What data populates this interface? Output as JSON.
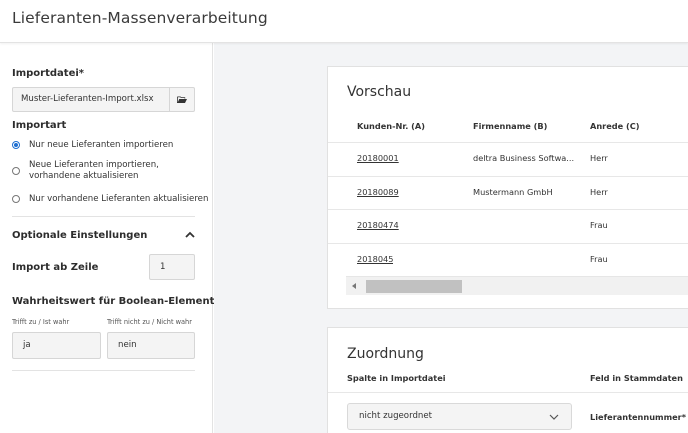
{
  "header": {
    "title": "Lieferanten-Massenverarbeitung"
  },
  "sidebar": {
    "import_file": {
      "label": "Importdatei*",
      "value": "Muster-Lieferanten-Import.xlsx",
      "browse_icon": "folder-open-icon"
    },
    "import_type": {
      "label": "Importart",
      "options": [
        {
          "label": "Nur neue Lieferanten importieren",
          "checked": true
        },
        {
          "label_line1": "Neue Lieferanten importieren,",
          "label_line2": "vorhandene aktualisieren",
          "checked": false
        },
        {
          "label": "Nur vorhandene Lieferanten aktualisieren",
          "checked": false
        }
      ]
    },
    "optional": {
      "label": "Optionale Einstellungen",
      "toggle_icon": "chevron-up-icon",
      "import_from_row": {
        "label": "Import ab Zeile",
        "value": "1"
      },
      "boolean": {
        "label": "Wahrheitswert für Boolean-Elemente",
        "true_caption": "Trifft zu / Ist wahr",
        "true_value": "ja",
        "false_caption": "Trifft nicht zu / Nicht wahr",
        "false_value": "nein"
      }
    }
  },
  "preview": {
    "title": "Vorschau",
    "columns": [
      "Kunden-Nr. (A)",
      "Firmenname (B)",
      "Anrede (C)"
    ],
    "rows": [
      {
        "kunden_nr": "20180001",
        "firmenname": "deltra Business Softwa...",
        "anrede": "Herr"
      },
      {
        "kunden_nr": "20180089",
        "firmenname": "Mustermann GmbH",
        "anrede": "Herr"
      },
      {
        "kunden_nr": "20180474",
        "firmenname": "",
        "anrede": "Frau"
      },
      {
        "kunden_nr": "2018045",
        "firmenname": "",
        "anrede": "Frau"
      }
    ]
  },
  "mapping": {
    "title": "Zuordnung",
    "col_import": "Spalte in Importdatei",
    "col_master": "Feld in Stammdaten",
    "select_value": "nicht zugeordnet",
    "field_value": "Lieferantennummer*"
  }
}
